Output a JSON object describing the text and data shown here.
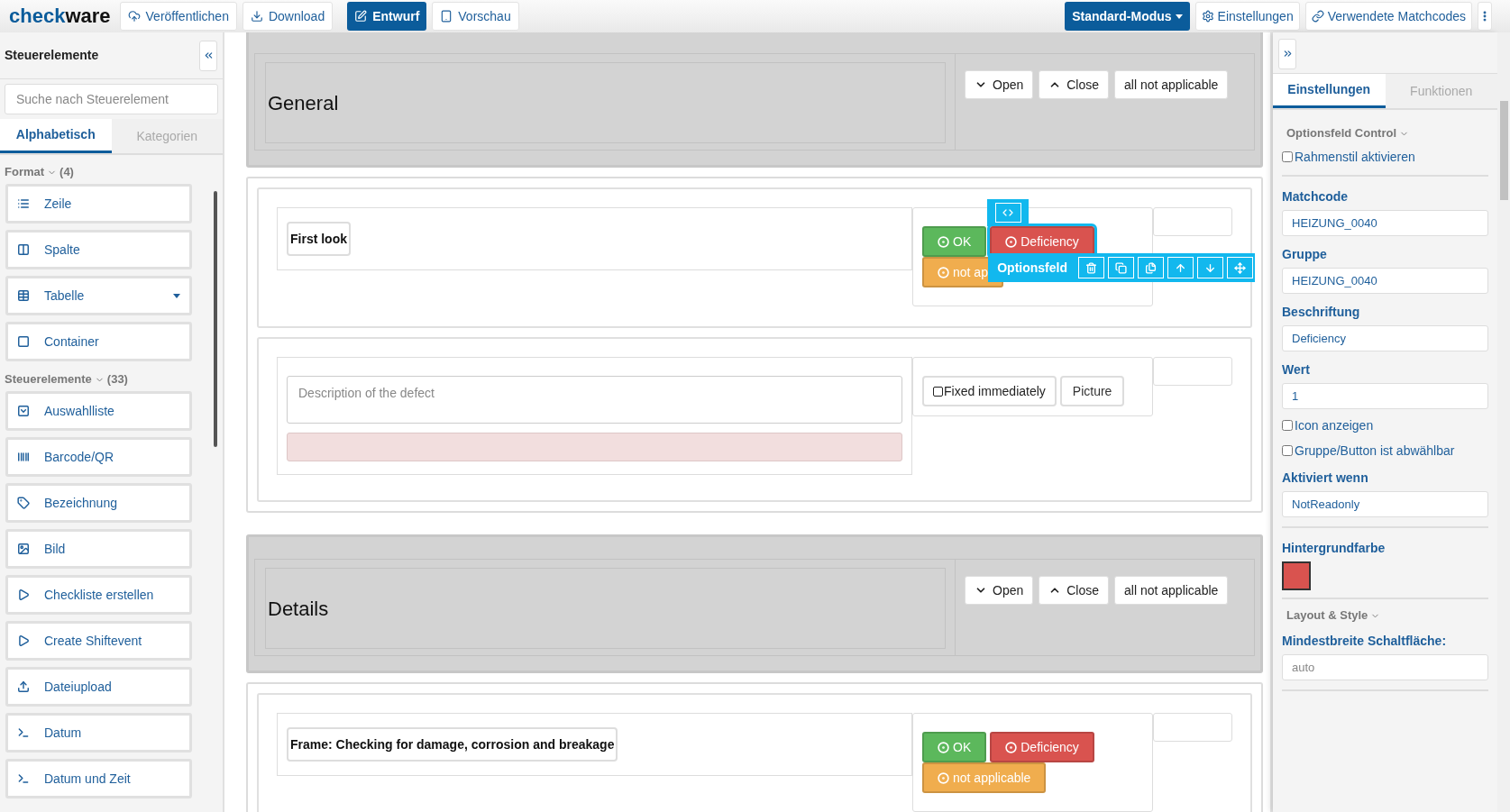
{
  "header": {
    "logo": {
      "first": "check",
      "second": "ware"
    },
    "left_buttons": [
      {
        "label": "Veröffentlichen",
        "selected": false
      },
      {
        "label": "Download",
        "selected": false
      },
      {
        "label": "Entwurf",
        "selected": true
      },
      {
        "label": "Vorschau",
        "selected": false
      }
    ],
    "mode": "Standard-Modus",
    "right_buttons": [
      "Einstellungen",
      "Verwendete Matchcodes"
    ]
  },
  "sidebar": {
    "title": "Steuerelemente",
    "search": {
      "placeholder": "Suche nach Steuerelement"
    },
    "tabs": [
      {
        "label": "Alphabetisch",
        "selected": true
      },
      {
        "label": "Kategorien",
        "selected": false
      }
    ],
    "groups": [
      {
        "title": "Format",
        "count": "(4)",
        "items": [
          "Zeile",
          "Spalte",
          "Tabelle",
          "Container"
        ]
      },
      {
        "title": "Steuerelemente",
        "count": "(33)",
        "items": [
          "Auswahlliste",
          "Barcode/QR",
          "Bezeichnung",
          "Bild",
          "Checkliste erstellen",
          "Create Shiftevent",
          "Dateiupload",
          "Datum",
          "Datum und Zeit"
        ]
      }
    ]
  },
  "sections": [
    {
      "kind": "header",
      "title": "General",
      "buttons": [
        "Open",
        "Close",
        "all not applicable"
      ]
    },
    {
      "kind": "body",
      "rows": [
        {
          "kind": "question",
          "label": "First look",
          "options": [
            {
              "label": "OK",
              "color": "#5cb85c",
              "selected": false
            },
            {
              "label": "Deficiency",
              "color": "#d9534f",
              "selected": true
            },
            {
              "label": "not ap",
              "color": "#f0ad4e",
              "selected": false
            }
          ]
        },
        {
          "kind": "defect",
          "placeholder": "Description of the defect",
          "actions": [
            {
              "kind": "checkbox",
              "label": "Fixed immediately",
              "checked": false
            },
            {
              "kind": "button",
              "label": "Picture"
            }
          ]
        }
      ]
    },
    {
      "kind": "header",
      "title": "Details",
      "buttons": [
        "Open",
        "Close",
        "all not applicable"
      ]
    },
    {
      "kind": "body",
      "rows": [
        {
          "kind": "question",
          "label": "Frame: Checking for damage, corrosion and breakage",
          "options": [
            {
              "label": "OK",
              "color": "#5cb85c",
              "selected": false
            },
            {
              "label": "Deficiency",
              "color": "#d9534f",
              "selected": false
            },
            {
              "label": "not applicable",
              "color": "#f0ad4e",
              "selected": false
            }
          ]
        }
      ]
    }
  ],
  "toolbar": {
    "label": "Optionsfeld"
  },
  "properties": {
    "tabs": [
      {
        "label": "Einstellungen",
        "selected": true
      },
      {
        "label": "Funktionen",
        "selected": false
      }
    ],
    "items": [
      {
        "kind": "section",
        "label": "Optionsfeld Control"
      },
      {
        "kind": "checkbox",
        "label": "Rahmenstil aktivieren",
        "checked": false
      },
      {
        "kind": "divider"
      },
      {
        "kind": "field",
        "label": "Matchcode",
        "value": "HEIZUNG_0040"
      },
      {
        "kind": "field",
        "label": "Gruppe",
        "value": "HEIZUNG_0040"
      },
      {
        "kind": "field",
        "label": "Beschriftung",
        "value": "Deficiency"
      },
      {
        "kind": "field",
        "label": "Wert",
        "value": "1"
      },
      {
        "kind": "checkbox",
        "label": "Icon anzeigen",
        "checked": false
      },
      {
        "kind": "checkbox",
        "label": "Gruppe/Button ist abwählbar",
        "checked": false
      },
      {
        "kind": "field",
        "label": "Aktiviert wenn",
        "value": "NotReadonly"
      },
      {
        "kind": "divider"
      },
      {
        "kind": "color",
        "label": "Hintergrundfarbe",
        "color": "#d9534f"
      },
      {
        "kind": "divider"
      },
      {
        "kind": "section",
        "label": "Layout & Style"
      },
      {
        "kind": "field",
        "label": "Mindestbreite Schaltfläche:",
        "placeholder": "auto"
      },
      {
        "kind": "divider"
      }
    ]
  }
}
